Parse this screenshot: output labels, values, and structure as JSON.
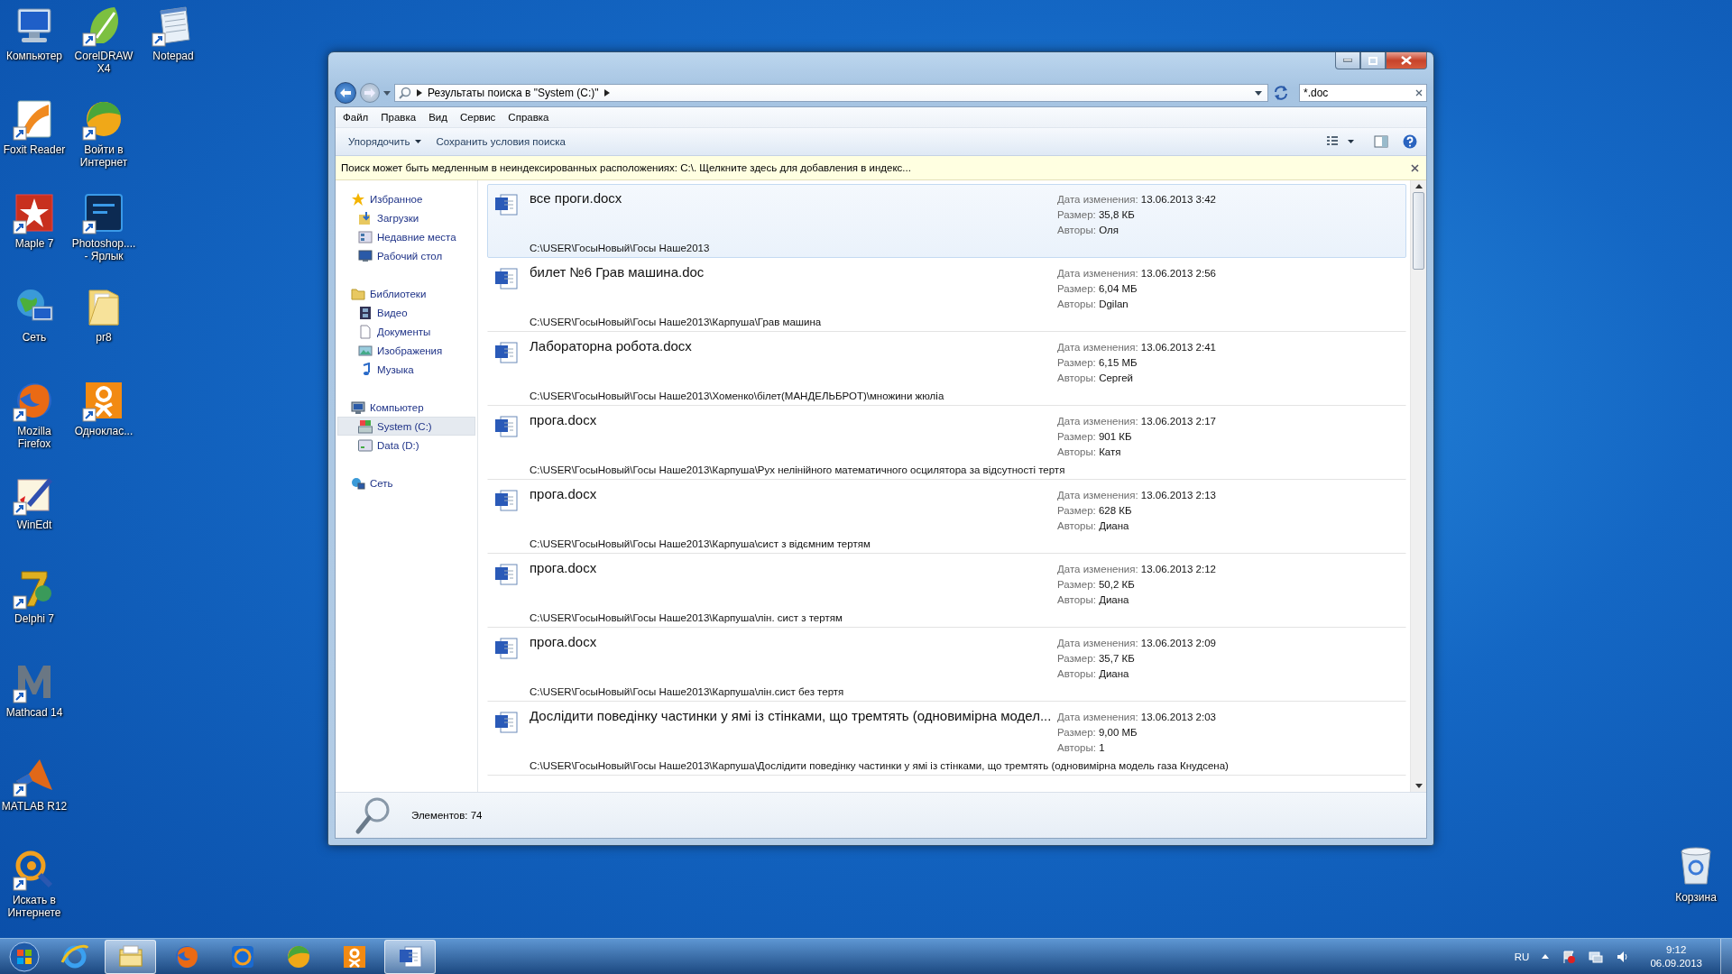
{
  "desktop": {
    "columns": [
      [
        {
          "label": "Компьютер",
          "kind": "computer",
          "shortcut": false
        },
        {
          "label": "Foxit Reader",
          "kind": "foxit",
          "shortcut": true
        },
        {
          "label": "Maple 7",
          "kind": "maple",
          "shortcut": true
        },
        {
          "label": "Сеть",
          "kind": "network",
          "shortcut": false
        },
        {
          "label": "Mozilla Firefox",
          "kind": "firefox",
          "shortcut": true
        },
        {
          "label": "WinEdt",
          "kind": "winedt",
          "shortcut": true
        },
        {
          "label": "Delphi 7",
          "kind": "delphi",
          "shortcut": true
        },
        {
          "label": "Mathcad 14",
          "kind": "mathcad",
          "shortcut": true
        },
        {
          "label": "MATLAB R12",
          "kind": "matlab",
          "shortcut": true
        },
        {
          "label": "Искать в Интернете",
          "kind": "search",
          "shortcut": true
        }
      ],
      [
        {
          "label": "CorelDRAW X4",
          "kind": "corel",
          "shortcut": true
        },
        {
          "label": "Войти в Интернет",
          "kind": "ball",
          "shortcut": true
        },
        {
          "label": "Photoshop.... - Ярлык",
          "kind": "photoshop",
          "shortcut": true
        },
        {
          "label": "pr8",
          "kind": "folder",
          "shortcut": false
        },
        {
          "label": "Одноклас...",
          "kind": "ok",
          "shortcut": true
        }
      ],
      [
        {
          "label": "Notepad",
          "kind": "notepad",
          "shortcut": true
        }
      ]
    ],
    "recycle_bin": {
      "label": "Корзина"
    }
  },
  "window": {
    "address": {
      "path": "Результаты поиска в \"System (C:)\""
    },
    "search": {
      "value": "*.doc"
    },
    "menu": [
      "Файл",
      "Правка",
      "Вид",
      "Сервис",
      "Справка"
    ],
    "toolbar": {
      "organize": "Упорядочить",
      "save_search": "Сохранить условия поиска"
    },
    "infobar": "Поиск может быть медленным в неиндексированных расположениях: C:\\. Щелкните здесь для добавления в индекс...",
    "sidebar": {
      "groups": [
        {
          "label": "Избранное",
          "kind": "star",
          "selected": false,
          "children": [
            {
              "label": "Загрузки",
              "kind": "downloads",
              "selected": false
            },
            {
              "label": "Недавние места",
              "kind": "recent",
              "selected": false
            },
            {
              "label": "Рабочий стол",
              "kind": "desktop",
              "selected": false
            }
          ]
        },
        {
          "label": "Библиотеки",
          "kind": "libraries",
          "selected": false,
          "children": [
            {
              "label": "Видео",
              "kind": "video",
              "selected": false
            },
            {
              "label": "Документы",
              "kind": "documents",
              "selected": false
            },
            {
              "label": "Изображения",
              "kind": "pictures",
              "selected": false
            },
            {
              "label": "Музыка",
              "kind": "music",
              "selected": false
            }
          ]
        },
        {
          "label": "Компьютер",
          "kind": "computer",
          "selected": false,
          "children": [
            {
              "label": "System (C:)",
              "kind": "drive_system",
              "selected": true
            },
            {
              "label": "Data (D:)",
              "kind": "drive",
              "selected": false
            }
          ]
        },
        {
          "label": "Сеть",
          "kind": "network",
          "selected": false
        }
      ]
    },
    "results": [
      {
        "name": "все проги.docx",
        "path": "C:\\USER\\ГосыНовый\\Госы Наше2013",
        "selected": true,
        "details": [
          {
            "label": "Дата изменения:",
            "value": "13.06.2013 3:42"
          },
          {
            "label": "Размер:",
            "value": "35,8 КБ"
          },
          {
            "label": "Авторы:",
            "value": "Оля"
          }
        ]
      },
      {
        "name": "билет №6 Грав машина.doc",
        "path": "C:\\USER\\ГосыНовый\\Госы Наше2013\\Карпуша\\Грав машина",
        "selected": false,
        "details": [
          {
            "label": "Дата изменения:",
            "value": "13.06.2013 2:56"
          },
          {
            "label": "Размер:",
            "value": "6,04 МБ"
          },
          {
            "label": "Авторы:",
            "value": "Dgilan"
          }
        ]
      },
      {
        "name": "Лабораторна робота.docx",
        "path": "C:\\USER\\ГосыНовый\\Госы Наше2013\\Хоменко\\білет(МАНДЕЛЬБРОТ)\\множини жюліа",
        "selected": false,
        "details": [
          {
            "label": "Дата изменения:",
            "value": "13.06.2013 2:41"
          },
          {
            "label": "Размер:",
            "value": "6,15 МБ"
          },
          {
            "label": "Авторы:",
            "value": "Сергей"
          }
        ]
      },
      {
        "name": "прога.docx",
        "path": "C:\\USER\\ГосыНовый\\Госы Наше2013\\Карпуша\\Рух нелінійного математичного осцилятора за відсутності тертя",
        "selected": false,
        "details": [
          {
            "label": "Дата изменения:",
            "value": "13.06.2013 2:17"
          },
          {
            "label": "Размер:",
            "value": "901 КБ"
          },
          {
            "label": "Авторы:",
            "value": "Катя"
          }
        ]
      },
      {
        "name": "прога.docx",
        "path": "C:\\USER\\ГосыНовый\\Госы Наше2013\\Карпуша\\сист з відємним тертям",
        "selected": false,
        "details": [
          {
            "label": "Дата изменения:",
            "value": "13.06.2013 2:13"
          },
          {
            "label": "Размер:",
            "value": "628 КБ"
          },
          {
            "label": "Авторы:",
            "value": "Диана"
          }
        ]
      },
      {
        "name": "прога.docx",
        "path": "C:\\USER\\ГосыНовый\\Госы Наше2013\\Карпуша\\лін. сист з тертям",
        "selected": false,
        "details": [
          {
            "label": "Дата изменения:",
            "value": "13.06.2013 2:12"
          },
          {
            "label": "Размер:",
            "value": "50,2 КБ"
          },
          {
            "label": "Авторы:",
            "value": "Диана"
          }
        ]
      },
      {
        "name": "прога.docx",
        "path": "C:\\USER\\ГосыНовый\\Госы Наше2013\\Карпуша\\лін.сист без тертя",
        "selected": false,
        "details": [
          {
            "label": "Дата изменения:",
            "value": "13.06.2013 2:09"
          },
          {
            "label": "Размер:",
            "value": "35,7 КБ"
          },
          {
            "label": "Авторы:",
            "value": "Диана"
          }
        ]
      },
      {
        "name": "Дослідити поведінку частинки у ямі із стінками, що тремтять (одновимірна модел...",
        "path": "C:\\USER\\ГосыНовый\\Госы Наше2013\\Карпуша\\Дослідити поведінку частинки у ямі із стінками, що тремтять (одновимірна модель газа Кнудсена)",
        "selected": false,
        "details": [
          {
            "label": "Дата изменения:",
            "value": "13.06.2013 2:03"
          },
          {
            "label": "Размер:",
            "value": "9,00 МБ"
          },
          {
            "label": "Авторы:",
            "value": "1"
          }
        ]
      }
    ],
    "status": {
      "count": "Элементов: 74"
    }
  },
  "taskbar": {
    "pins": [
      {
        "kind": "ie",
        "active": false
      },
      {
        "kind": "explorer",
        "active": true
      },
      {
        "kind": "firefox",
        "active": false
      },
      {
        "kind": "mail",
        "active": false
      },
      {
        "kind": "ball",
        "active": false
      },
      {
        "kind": "ok",
        "active": false
      },
      {
        "kind": "word",
        "active": true
      }
    ],
    "tray": {
      "language": "RU",
      "time": "9:12",
      "date": "06.09.2013"
    }
  }
}
